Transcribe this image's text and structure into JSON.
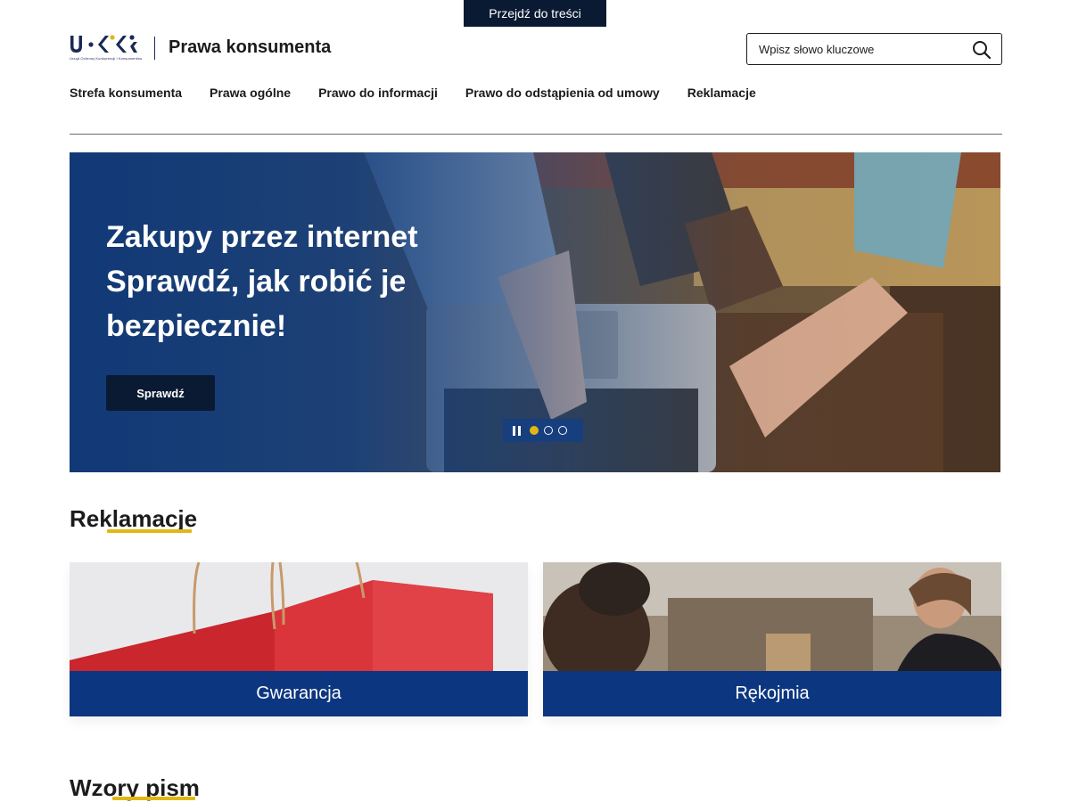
{
  "skip_link": "Przejdź do treści",
  "header": {
    "logo_text": "U·K·K",
    "logo_subtitle": "Urząd Ochrony Konkurencji i Konsumentów",
    "site_title": "Prawa konsumenta",
    "search_placeholder": "Wpisz słowo kluczowe",
    "search_icon": "search-icon"
  },
  "nav": {
    "items": [
      {
        "label": "Strefa konsumenta"
      },
      {
        "label": "Prawa ogólne"
      },
      {
        "label": "Prawo do informacji"
      },
      {
        "label": "Prawo do odstąpienia od umowy"
      },
      {
        "label": "Reklamacje"
      }
    ]
  },
  "hero": {
    "title": "Zakupy przez internet Sprawdź, jak robić je bezpiecznie!",
    "button_label": "Sprawdź",
    "slides_total": 3,
    "active_slide": 1,
    "pause_icon": "pause-icon"
  },
  "sections": {
    "reklamacje": {
      "heading": "Reklamacje",
      "cards": [
        {
          "label": "Gwarancja"
        },
        {
          "label": "Rękojmia"
        }
      ]
    },
    "wzory": {
      "heading": "Wzory pism"
    }
  },
  "colors": {
    "navy": "#0b1a33",
    "brand_blue": "#0d3680",
    "accent_yellow": "#e2b713"
  }
}
